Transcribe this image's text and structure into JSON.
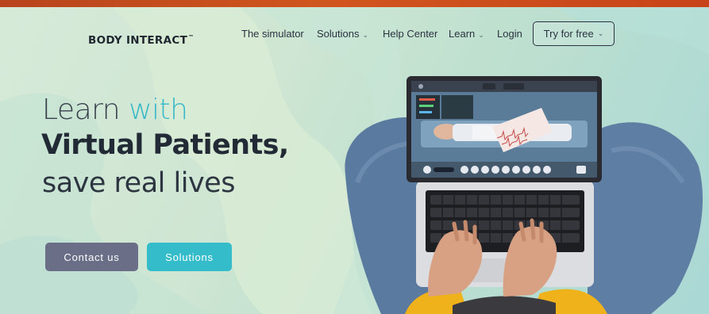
{
  "brand": {
    "name": "BODY INTERACT",
    "trademark": "™"
  },
  "nav": {
    "items": [
      {
        "label": "The simulator",
        "has_dropdown": false
      },
      {
        "label": "Solutions",
        "has_dropdown": true
      },
      {
        "label": "Help Center",
        "has_dropdown": false
      },
      {
        "label": "Learn",
        "has_dropdown": true
      },
      {
        "label": "Login",
        "has_dropdown": false
      }
    ],
    "cta": {
      "label": "Try for free",
      "has_dropdown": true
    }
  },
  "hero": {
    "line1_a": "Learn",
    "line1_b": "with",
    "line2": "Virtual Patients,",
    "line3": "save real lives",
    "buttons": {
      "contact": "Contact us",
      "solutions": "Solutions"
    }
  },
  "icons": {
    "dropdown": "chevron-down-icon"
  },
  "colors": {
    "top_strip": "#c8491c",
    "accent_teal": "#39b8c8",
    "contact_button": "#6a6e87",
    "solutions_button": "#35bccb",
    "text_dark": "#222a35"
  }
}
